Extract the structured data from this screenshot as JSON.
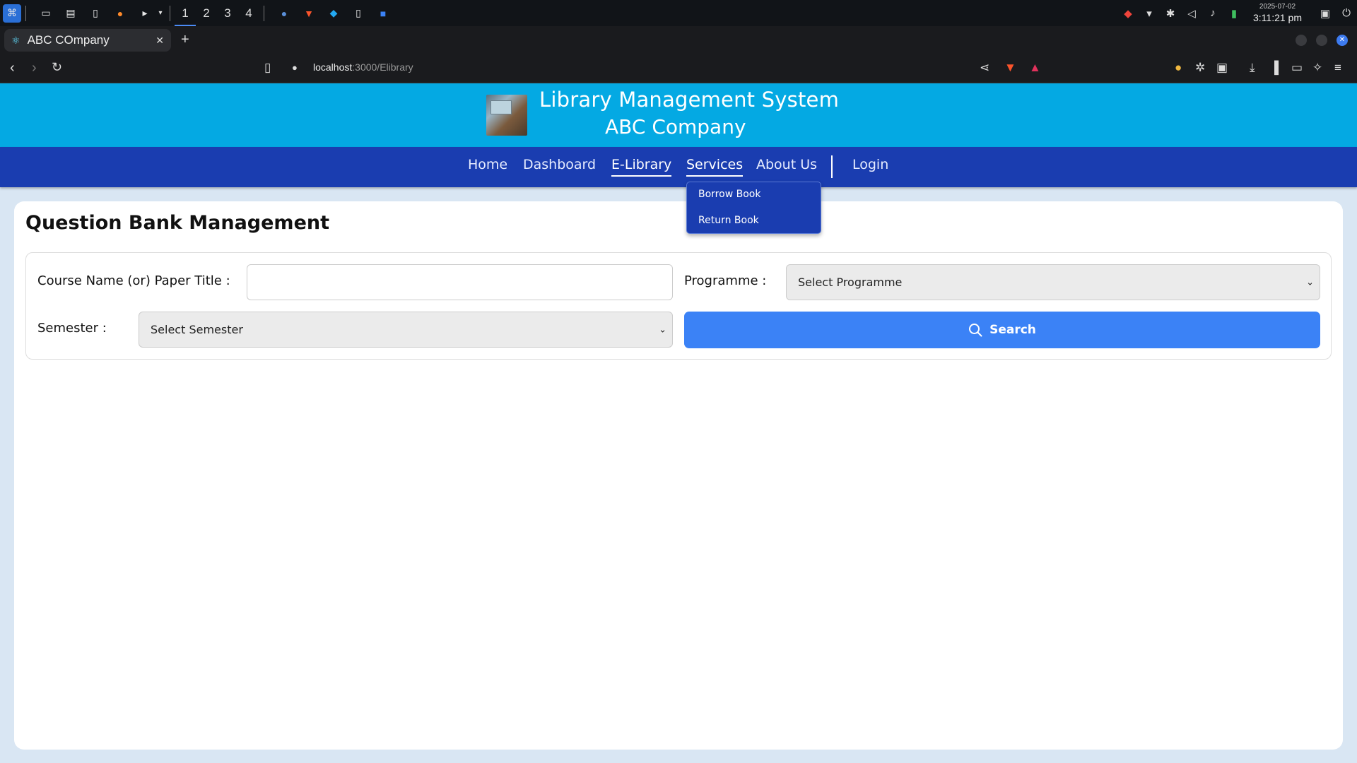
{
  "taskbar": {
    "workspaces": [
      "1",
      "2",
      "3",
      "4"
    ],
    "clock": {
      "date": "2025-07-02",
      "time": "3:11:21 pm"
    }
  },
  "browser": {
    "tab_title": "ABC COmpany",
    "new_tab": "+",
    "url_host": "localhost",
    "url_path": ":3000/Elibrary"
  },
  "header": {
    "title": "Library Management System",
    "subtitle": "ABC Company"
  },
  "nav": {
    "home": "Home",
    "dashboard": "Dashboard",
    "elibrary": "E-Library",
    "services": "Services",
    "about": "About Us",
    "login": "Login"
  },
  "services_menu": {
    "borrow": "Borrow Book",
    "return": "Return Book"
  },
  "main": {
    "title": "Question Bank Management",
    "course_label": "Course Name (or) Paper Title :",
    "course_value": "",
    "programme_label": "Programme :",
    "programme_selected": "Select Programme",
    "semester_label": "Semester :",
    "semester_selected": "Select Semester",
    "search_label": "Search"
  },
  "colors": {
    "header_bg": "#04a9e3",
    "nav_bg": "#1a3db0",
    "search_button": "#3b82f6",
    "page_bg": "#d9e6f3"
  }
}
